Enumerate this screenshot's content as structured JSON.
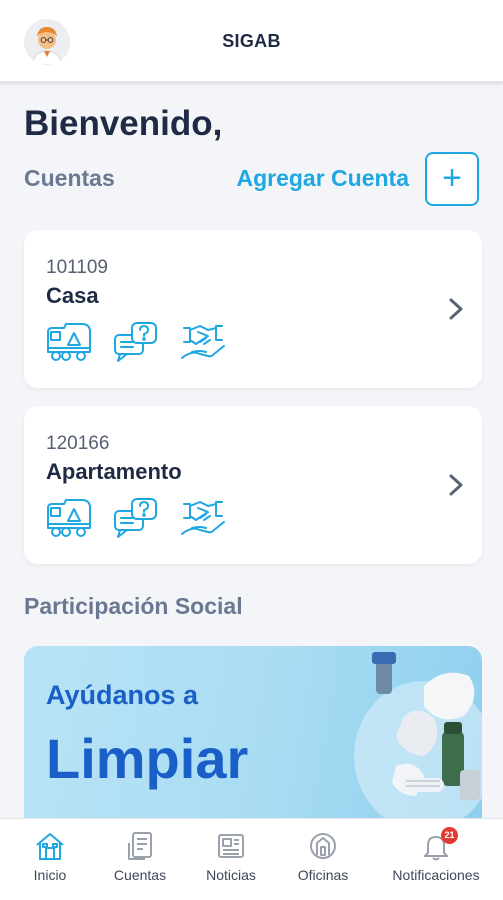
{
  "header": {
    "title": "SIGAB",
    "avatar_icon": "user-avatar"
  },
  "welcome": "Bienvenido,",
  "accounts": {
    "section_title": "Cuentas",
    "add_label": "Agregar Cuenta",
    "add_button": "+",
    "items": [
      {
        "number": "101109",
        "name": "Casa",
        "icons": [
          "truck-icon",
          "chat-question-icon",
          "handshake-icon"
        ]
      },
      {
        "number": "120166",
        "name": "Apartamento",
        "icons": [
          "truck-icon",
          "chat-question-icon",
          "handshake-icon"
        ]
      }
    ]
  },
  "social": {
    "section_title": "Participación Social",
    "banner_line1": "Ayúdanos a",
    "banner_line2": "Limpiar"
  },
  "tabbar": {
    "tabs": [
      {
        "label": "Inicio",
        "icon": "home-icon",
        "active": true
      },
      {
        "label": "Cuentas",
        "icon": "bill-icon"
      },
      {
        "label": "Noticias",
        "icon": "news-icon"
      },
      {
        "label": "Oficinas",
        "icon": "office-icon"
      },
      {
        "label": "Notificaciones",
        "icon": "bell-icon",
        "badge": "21"
      }
    ]
  },
  "colors": {
    "accent": "#1ea7e1",
    "title": "#1f2a44",
    "section": "#6b7892",
    "banner_text": "#1a5fc8",
    "badge": "#e53935"
  }
}
